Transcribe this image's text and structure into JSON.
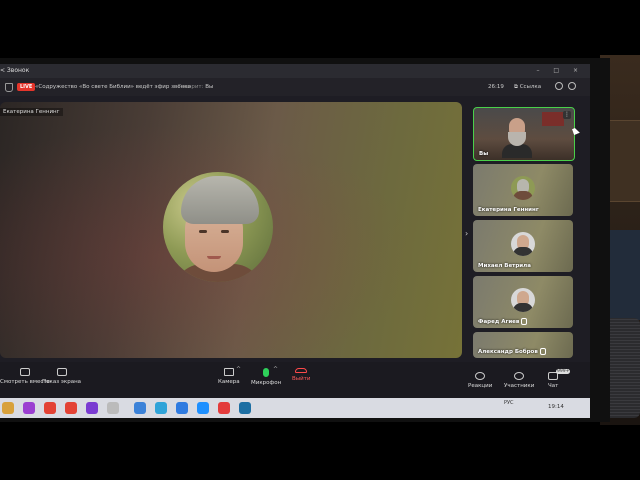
{
  "app": {
    "back_label": "< Звонок",
    "window_controls": "–  □  ×",
    "live_badge": "LIVE",
    "title": "«Содружество «Во свете Библии» ведёт эфир звонка",
    "speaking_prefix": "Говорит:",
    "speaking_name": "Вы",
    "timer": "26:19",
    "copy_link_label": "Ссылка"
  },
  "main_video": {
    "participant_name": "Екатерина Геннинг"
  },
  "participants": [
    {
      "name": "Вы",
      "muted": false
    },
    {
      "name": "Екатерина Геннинг",
      "muted": false
    },
    {
      "name": "Михаел Ветрила",
      "muted": false
    },
    {
      "name": "Фаред Агиев",
      "muted": true
    },
    {
      "name": "Александр Бобров",
      "muted": true
    }
  ],
  "controls": {
    "watch_together": "Смотреть вместе",
    "share_screen": "Показ экрана",
    "camera": "Камера",
    "microphone": "Микрофон",
    "leave": "Выйти",
    "reactions": "Реакции",
    "participants": "Участники",
    "chat": "Чат",
    "chat_badge": "999+"
  },
  "taskbar": {
    "tray_text": "РУС",
    "clock": "19:14",
    "app_colors": [
      "#d8a13b",
      "#9b3fd1",
      "#e34234",
      "#e34234",
      "#7a3bd1",
      "#bbbbbb",
      "#3b82d8",
      "#2fa3d8",
      "#2f7be0",
      "#1e90ff",
      "#e33b3b",
      "#1d6fa3"
    ]
  },
  "colors": {
    "live": "#e5352b",
    "mic_active": "#2fd05a",
    "leave": "#ff5b5b",
    "active_speaker_border": "#4ad04a"
  }
}
